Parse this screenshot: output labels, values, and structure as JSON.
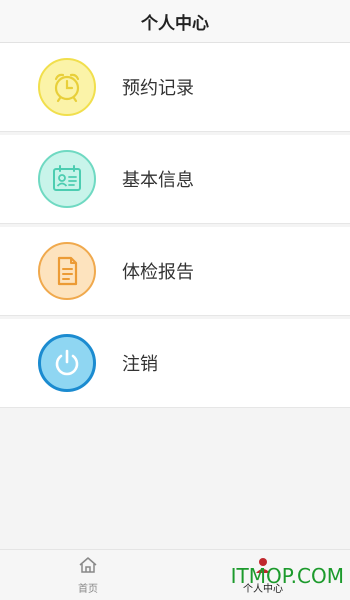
{
  "header": {
    "title": "个人中心"
  },
  "menu": {
    "items": [
      {
        "label": "预约记录",
        "icon": "alarm-clock-icon",
        "color": "#f1df4d"
      },
      {
        "label": "基本信息",
        "icon": "id-card-icon",
        "color": "#6fd9c2"
      },
      {
        "label": "体检报告",
        "icon": "document-icon",
        "color": "#f0a94d"
      },
      {
        "label": "注销",
        "icon": "power-icon",
        "color": "#1b8bd0"
      }
    ]
  },
  "tabbar": {
    "home_label": "首页",
    "me_label": "个人中心",
    "active": "个人中心"
  },
  "watermark": {
    "text": "ITMOP.COM"
  }
}
